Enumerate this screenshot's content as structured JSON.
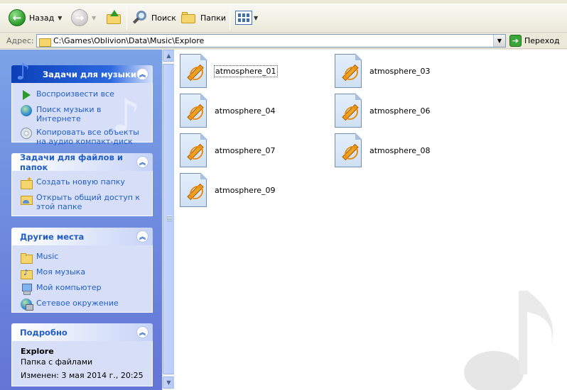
{
  "toolbar": {
    "back_label": "Назад",
    "search_label": "Поиск",
    "folders_label": "Папки"
  },
  "address": {
    "label": "Адрес:",
    "path": "C:\\Games\\Oblivion\\Data\\Music\\Explore",
    "go_label": "Переход"
  },
  "panels": {
    "music_tasks": {
      "title": "Задачи для музыки",
      "items": [
        "Воспроизвести все",
        "Поиск музыки в Интернете",
        "Копировать все объекты на аудио компакт-диск"
      ]
    },
    "file_tasks": {
      "title": "Задачи для файлов и папок",
      "items": [
        "Создать новую папку",
        "Открыть общий доступ к этой папке"
      ]
    },
    "other_places": {
      "title": "Другие места",
      "items": [
        "Music",
        "Моя музыка",
        "Мой компьютер",
        "Сетевое окружение"
      ]
    },
    "details": {
      "title": "Подробно",
      "name": "Explore",
      "type": "Папка с файлами",
      "modified": "Изменен: 3 мая 2014 г., 20:25"
    }
  },
  "files": [
    "atmosphere_01",
    "atmosphere_03",
    "atmosphere_04",
    "atmosphere_06",
    "atmosphere_07",
    "atmosphere_08",
    "atmosphere_09"
  ],
  "colors": {
    "task_pane_top": "#7ba2e7",
    "task_pane_bottom": "#6375d6",
    "link_blue": "#215dc6"
  }
}
